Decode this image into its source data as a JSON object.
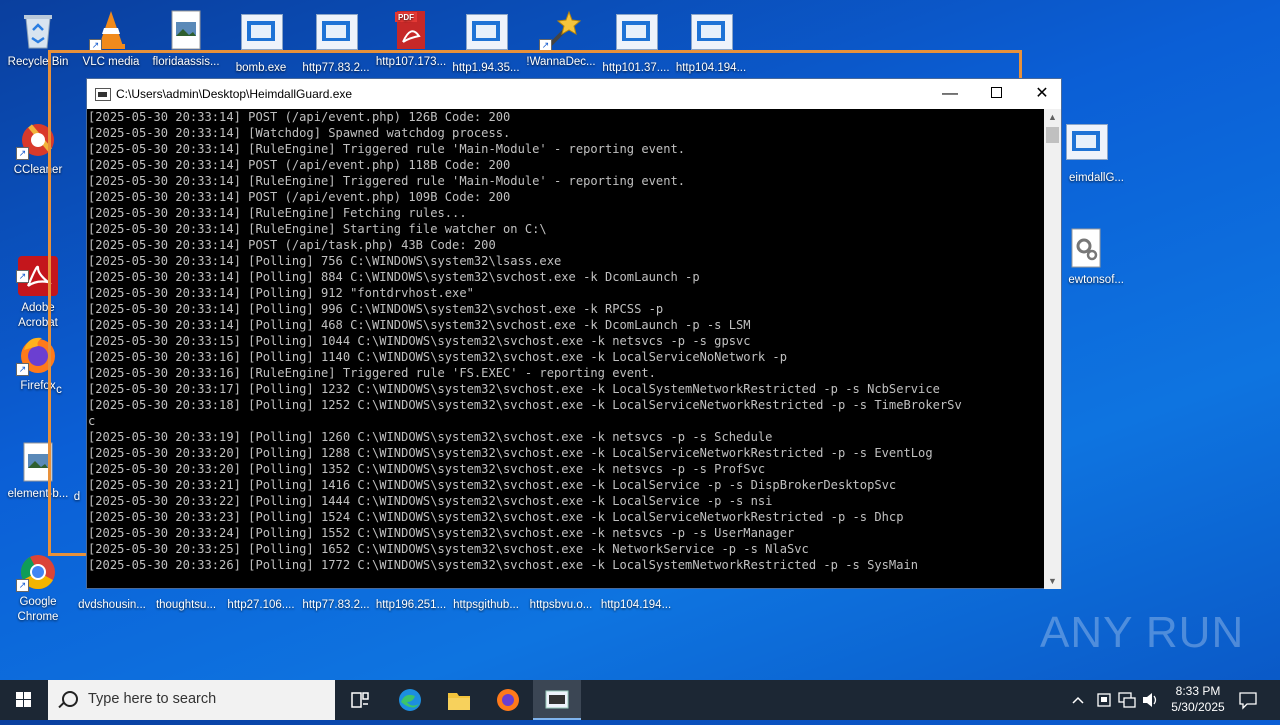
{
  "desktop": {
    "icons": [
      {
        "label": "Recycle Bin"
      },
      {
        "label": "VLC media"
      },
      {
        "label": "floridaassis..."
      },
      {
        "label": "bomb.exe"
      },
      {
        "label": "http77.83.2..."
      },
      {
        "label": "http107.173..."
      },
      {
        "label": "http1.94.35..."
      },
      {
        "label": "!WannaDec..."
      },
      {
        "label": "http101.37...."
      },
      {
        "label": "http104.194..."
      },
      {
        "label": "CCleaner"
      },
      {
        "label": "Adobe\nAcrobat"
      },
      {
        "label": "Firefox"
      },
      {
        "label": "element-b..."
      },
      {
        "label": "Google\nChrome"
      },
      {
        "label": "dvdshousin..."
      },
      {
        "label": "thoughtsu..."
      },
      {
        "label": "http27.106...."
      },
      {
        "label": "http77.83.2..."
      },
      {
        "label": "http196.251..."
      },
      {
        "label": "httpsgithub..."
      },
      {
        "label": "httpsbvu.o..."
      },
      {
        "label": "http104.194..."
      },
      {
        "label": "eimdallG..."
      },
      {
        "label": "ewtonsof..."
      }
    ],
    "partial_labels": [
      "c",
      "d"
    ]
  },
  "console_window": {
    "title": "C:\\Users\\admin\\Desktop\\HeimdallGuard.exe",
    "lines": [
      "[2025-05-30 20:33:14] POST (/api/event.php) 126B Code: 200",
      "[2025-05-30 20:33:14] [Watchdog] Spawned watchdog process.",
      "[2025-05-30 20:33:14] [RuleEngine] Triggered rule 'Main-Module' - reporting event.",
      "[2025-05-30 20:33:14] POST (/api/event.php) 118B Code: 200",
      "[2025-05-30 20:33:14] [RuleEngine] Triggered rule 'Main-Module' - reporting event.",
      "[2025-05-30 20:33:14] POST (/api/event.php) 109B Code: 200",
      "[2025-05-30 20:33:14] [RuleEngine] Fetching rules...",
      "[2025-05-30 20:33:14] [RuleEngine] Starting file watcher on C:\\",
      "[2025-05-30 20:33:14] POST (/api/task.php) 43B Code: 200",
      "[2025-05-30 20:33:14] [Polling] 756 C:\\WINDOWS\\system32\\lsass.exe",
      "[2025-05-30 20:33:14] [Polling] 884 C:\\WINDOWS\\system32\\svchost.exe -k DcomLaunch -p",
      "[2025-05-30 20:33:14] [Polling] 912 \"fontdrvhost.exe\"",
      "[2025-05-30 20:33:14] [Polling] 996 C:\\WINDOWS\\system32\\svchost.exe -k RPCSS -p",
      "[2025-05-30 20:33:14] [Polling] 468 C:\\WINDOWS\\system32\\svchost.exe -k DcomLaunch -p -s LSM",
      "[2025-05-30 20:33:15] [Polling] 1044 C:\\WINDOWS\\system32\\svchost.exe -k netsvcs -p -s gpsvc",
      "[2025-05-30 20:33:16] [Polling] 1140 C:\\WINDOWS\\system32\\svchost.exe -k LocalServiceNoNetwork -p",
      "[2025-05-30 20:33:16] [RuleEngine] Triggered rule 'FS.EXEC' - reporting event.",
      "[2025-05-30 20:33:17] [Polling] 1232 C:\\WINDOWS\\system32\\svchost.exe -k LocalSystemNetworkRestricted -p -s NcbService",
      "[2025-05-30 20:33:18] [Polling] 1252 C:\\WINDOWS\\system32\\svchost.exe -k LocalServiceNetworkRestricted -p -s TimeBrokerSv",
      "c",
      "[2025-05-30 20:33:19] [Polling] 1260 C:\\WINDOWS\\system32\\svchost.exe -k netsvcs -p -s Schedule",
      "[2025-05-30 20:33:20] [Polling] 1288 C:\\WINDOWS\\system32\\svchost.exe -k LocalServiceNetworkRestricted -p -s EventLog",
      "[2025-05-30 20:33:20] [Polling] 1352 C:\\WINDOWS\\system32\\svchost.exe -k netsvcs -p -s ProfSvc",
      "[2025-05-30 20:33:21] [Polling] 1416 C:\\WINDOWS\\system32\\svchost.exe -k LocalService -p -s DispBrokerDesktopSvc",
      "[2025-05-30 20:33:22] [Polling] 1444 C:\\WINDOWS\\system32\\svchost.exe -k LocalService -p -s nsi",
      "[2025-05-30 20:33:23] [Polling] 1524 C:\\WINDOWS\\system32\\svchost.exe -k LocalServiceNetworkRestricted -p -s Dhcp",
      "[2025-05-30 20:33:24] [Polling] 1552 C:\\WINDOWS\\system32\\svchost.exe -k netsvcs -p -s UserManager",
      "[2025-05-30 20:33:25] [Polling] 1652 C:\\WINDOWS\\system32\\svchost.exe -k NetworkService -p -s NlaSvc",
      "[2025-05-30 20:33:26] [Polling] 1772 C:\\WINDOWS\\system32\\svchost.exe -k LocalSystemNetworkRestricted -p -s SysMain"
    ]
  },
  "watermark": "ANY RUN",
  "taskbar": {
    "search_placeholder": "Type here to search",
    "clock_time": "8:33 PM",
    "clock_date": "5/30/2025"
  },
  "colors": {
    "desktop_blue": "#0b5fd6",
    "highlight_frame": "#e8913a",
    "console_bg": "#000000",
    "console_text": "#c0c0c0",
    "taskbar": "#1c2734"
  }
}
